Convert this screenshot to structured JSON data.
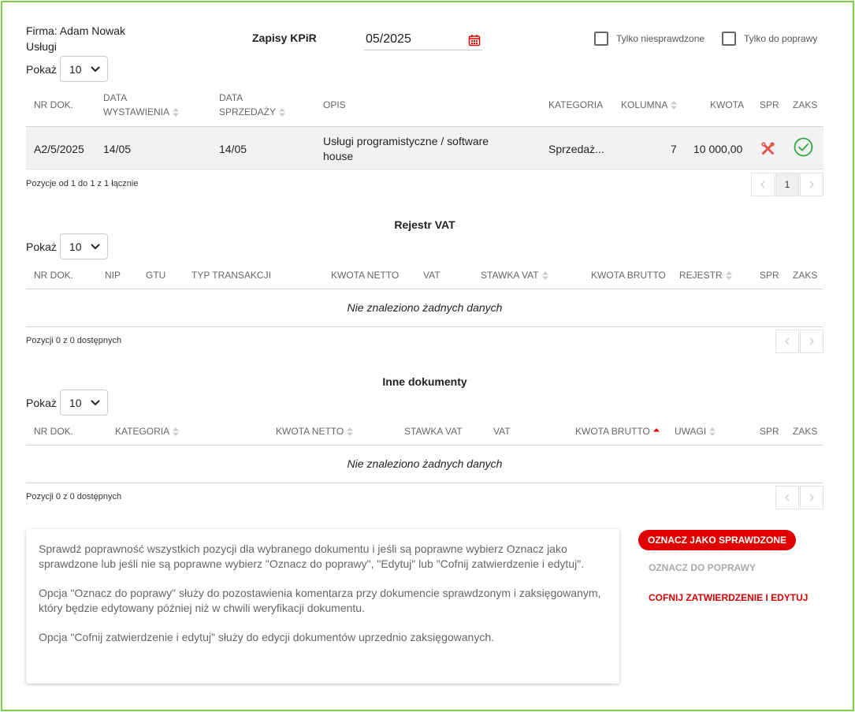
{
  "header": {
    "company_line1": "Firma: Adam Nowak",
    "company_line2": "Usługi",
    "title": "Zapisy KPiR",
    "period": "05/2025",
    "filter_unchecked_label": "Tylko niesprawdzone",
    "filter_to_fix_label": "Tylko do poprawy"
  },
  "kpir": {
    "show_label": "Pokaż",
    "show_value": "10",
    "columns": {
      "nr": "NR DOK.",
      "date_issue_1": "DATA",
      "date_issue_2": "WYSTAWIENIA",
      "date_sale_1": "DATA",
      "date_sale_2": "SPRZEDAŻY",
      "desc": "OPIS",
      "category": "KATEGORIA",
      "column": "KOLUMNA",
      "amount": "KWOTA",
      "spr": "SPR",
      "zaks": "ZAKS"
    },
    "rows": [
      {
        "nr": "A2/5/2025",
        "date_issue": "14/05",
        "date_sale": "14/05",
        "desc_1": "Usługi programistyczne / software",
        "desc_2": "house",
        "category": "Sprzedaż...",
        "column": "7",
        "amount": "10 000,00"
      }
    ],
    "info": "Pozycje od 1 do 1 z 1 łącznie",
    "current_page": "1"
  },
  "vat": {
    "title": "Rejestr VAT",
    "show_label": "Pokaż",
    "show_value": "10",
    "columns": {
      "nr": "NR DOK.",
      "nip": "NIP",
      "gtu": "GTU",
      "type": "TYP TRANSAKCJI",
      "net": "KWOTA NETTO",
      "vat": "VAT",
      "rate": "STAWKA VAT",
      "gross": "KWOTA BRUTTO",
      "register": "REJESTR",
      "spr": "SPR",
      "zaks": "ZAKS"
    },
    "empty": "Nie znaleziono żadnych danych",
    "info": "Pozycji 0 z 0 dostępnych"
  },
  "other": {
    "title": "Inne dokumenty",
    "show_label": "Pokaż",
    "show_value": "10",
    "columns": {
      "nr": "NR DOK.",
      "category": "KATEGORIA",
      "net": "KWOTA NETTO",
      "rate": "STAWKA VAT",
      "vat": "VAT",
      "gross": "KWOTA BRUTTO",
      "notes": "UWAGI",
      "spr": "SPR",
      "zaks": "ZAKS"
    },
    "empty": "Nie znaleziono żadnych danych",
    "info": "Pozycji 0 z 0 dostępnych"
  },
  "help": {
    "p1": "Sprawdź poprawność wszystkich pozycji dla wybranego dokumentu i jeśli są poprawne wybierz Oznacz jako sprawdzone lub jeśli nie są poprawne wybierz \"Oznacz do poprawy\", \"Edytuj\" lub \"Cofnij zatwierdzenie i edytuj\".",
    "p2": "Opcja \"Oznacz do poprawy\" służy do pozostawienia komentarza przy dokumencie sprawdzonym i zaksięgowanym, który będzie edytowany później niż w chwili weryfikacji dokumentu.",
    "p3": "Opcja \"Cofnij zatwierdzenie i edytuj\" służy do edycji dokumentów uprzednio zaksięgowanych."
  },
  "actions": {
    "mark_checked": "OZNACZ JAKO SPRAWDZONE",
    "mark_to_fix": "OZNACZ DO POPRAWY",
    "revert_edit": "COFNIJ ZATWIERDZENIE I EDYTUJ"
  },
  "colors": {
    "accent_red": "#e10000",
    "frame_green": "#7ed04b",
    "ok_green": "#2eaa3c"
  },
  "icons": {
    "calendar": "calendar-icon",
    "spr_status": "wrench-cross-icon",
    "zaks_status": "check-circle-icon",
    "sort": "sort-icon",
    "sort_up": "sort-up-icon"
  }
}
